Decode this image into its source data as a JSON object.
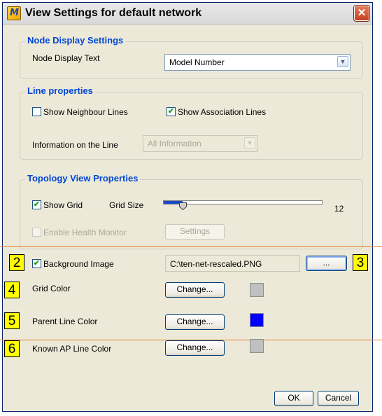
{
  "dialog": {
    "title": "View Settings for default network",
    "app_icon_letter": "M",
    "close_glyph": "✕"
  },
  "node_display": {
    "legend": "Node Display Settings",
    "label": "Node Display Text",
    "selected": "Model Number"
  },
  "line_properties": {
    "legend": "Line properties",
    "show_neighbour": {
      "label": "Show Neighbour Lines",
      "checked": false
    },
    "show_association": {
      "label": "Show Association Lines",
      "checked": true
    },
    "info_label": "Information on the Line",
    "info_selected": "All Information"
  },
  "topology": {
    "legend": "Topology View Properties",
    "show_grid": {
      "label": "Show Grid",
      "checked": true
    },
    "grid_size_label": "Grid Size",
    "grid_size_value": "12",
    "grid_size_fraction": 0.12,
    "health_monitor": {
      "label": "Enable Health Monitor",
      "checked": false
    },
    "settings_button": "Settings"
  },
  "extra": {
    "background_image": {
      "label": "Background Image",
      "checked": true,
      "path": "C:\\ten-net-rescaled.PNG",
      "browse": "..."
    },
    "grid_color": {
      "label": "Grid Color",
      "button": "Change...",
      "color": "#c0c0c0"
    },
    "parent_line_color": {
      "label": "Parent Line Color",
      "button": "Change...",
      "color": "#0000ff"
    },
    "known_ap_line_color": {
      "label": "Known AP Line Color",
      "button": "Change...",
      "color": "#c0c0c0"
    }
  },
  "callouts": [
    "2",
    "3",
    "4",
    "5",
    "6"
  ],
  "footer": {
    "ok": "OK",
    "cancel": "Cancel"
  },
  "icons": {
    "check": "✔",
    "dropdown": "▼"
  }
}
